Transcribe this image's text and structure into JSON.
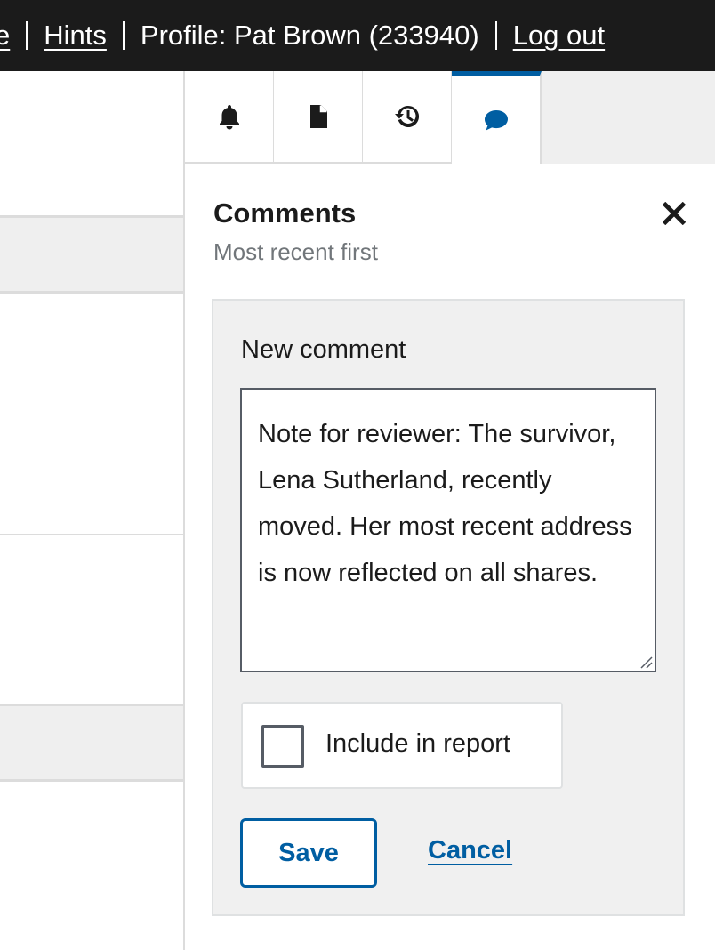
{
  "topbar": {
    "partial_item": "e",
    "hints": "Hints",
    "profile": "Profile: Pat Brown (233940)",
    "logout": "Log out"
  },
  "tabs": [
    {
      "icon": "bell-icon",
      "active": false
    },
    {
      "icon": "document-icon",
      "active": false
    },
    {
      "icon": "history-icon",
      "active": false
    },
    {
      "icon": "comment-icon",
      "active": true
    }
  ],
  "comments_panel": {
    "title": "Comments",
    "subtitle": "Most recent first",
    "new_comment_label": "New comment",
    "comment_text": "Note for reviewer: The survivor, Lena Sutherland, recently moved. Her most recent address is now reflected on all shares.",
    "include_in_report_label": "Include in report",
    "include_in_report_checked": false,
    "save_label": "Save",
    "cancel_label": "Cancel"
  },
  "colors": {
    "topbar_bg": "#1b1b1b",
    "accent": "#005ea2",
    "panel_box_bg": "#f0f0f0"
  }
}
